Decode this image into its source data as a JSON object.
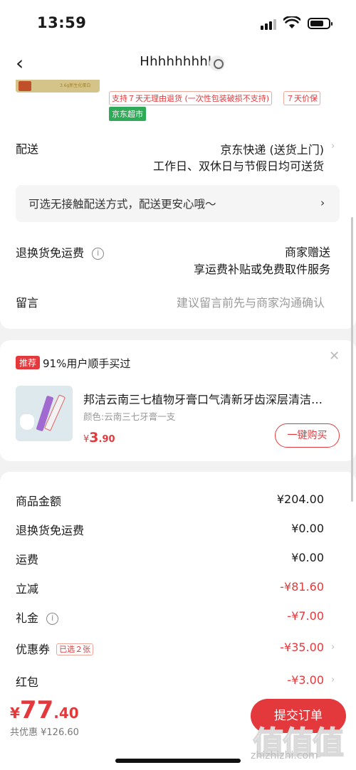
{
  "status_bar": {
    "time": "13:59"
  },
  "nav": {
    "title": "Hhhhhhhhh"
  },
  "product": {
    "tag_return": "支持７天无理由退货 (一次性包装破损不支持)",
    "tag_price": "７天价保",
    "tag_store": "京东超市",
    "thumb_text": "3.6g新生化蛋白"
  },
  "delivery": {
    "label": "配送",
    "method": "京东快递 (送货上门)",
    "schedule": "工作日、双休日与节假日均可送货",
    "notice": "可选无接触配送方式，配送更安心哦～"
  },
  "return_shipping": {
    "label": "退换货免运费",
    "value": "商家赠送",
    "sub": "享运费补贴或免费取件服务"
  },
  "message": {
    "label": "留言",
    "placeholder": "建议留言前先与商家沟通确认"
  },
  "recommend": {
    "badge": "推荐",
    "headline": "91%用户顺手买过",
    "name": "邦洁云南三七植物牙膏口气清新牙齿深层清洁…",
    "spec": "颜色:云南三七牙膏一支",
    "price_symbol": "¥",
    "price_int": "3",
    "price_dec": ".90",
    "buy_label": "一键购买"
  },
  "summary": [
    {
      "label": "商品金额",
      "value": "¥204.00",
      "red": false
    },
    {
      "label": "退换货免运费",
      "value": "¥0.00",
      "red": false
    },
    {
      "label": "运费",
      "value": "¥0.00",
      "red": false
    },
    {
      "label": "立减",
      "value": "-¥81.60",
      "red": true
    },
    {
      "label": "礼金",
      "value": "-¥7.00",
      "red": true
    },
    {
      "label": "优惠券",
      "value": "-¥35.00",
      "red": true
    },
    {
      "label": "红包",
      "value": "-¥3.00",
      "red": true
    }
  ],
  "coupon_tag": "已选２张",
  "footer": {
    "symbol": "¥",
    "total_int": "77",
    "total_dec": ".40",
    "saved": "共优惠 ¥126.60",
    "submit": "提交订单",
    "watermark": "值值值",
    "watermark_url": "zhizhizhi.com"
  },
  "colors": {
    "accent": "#e4393c",
    "green": "#2faa57"
  }
}
